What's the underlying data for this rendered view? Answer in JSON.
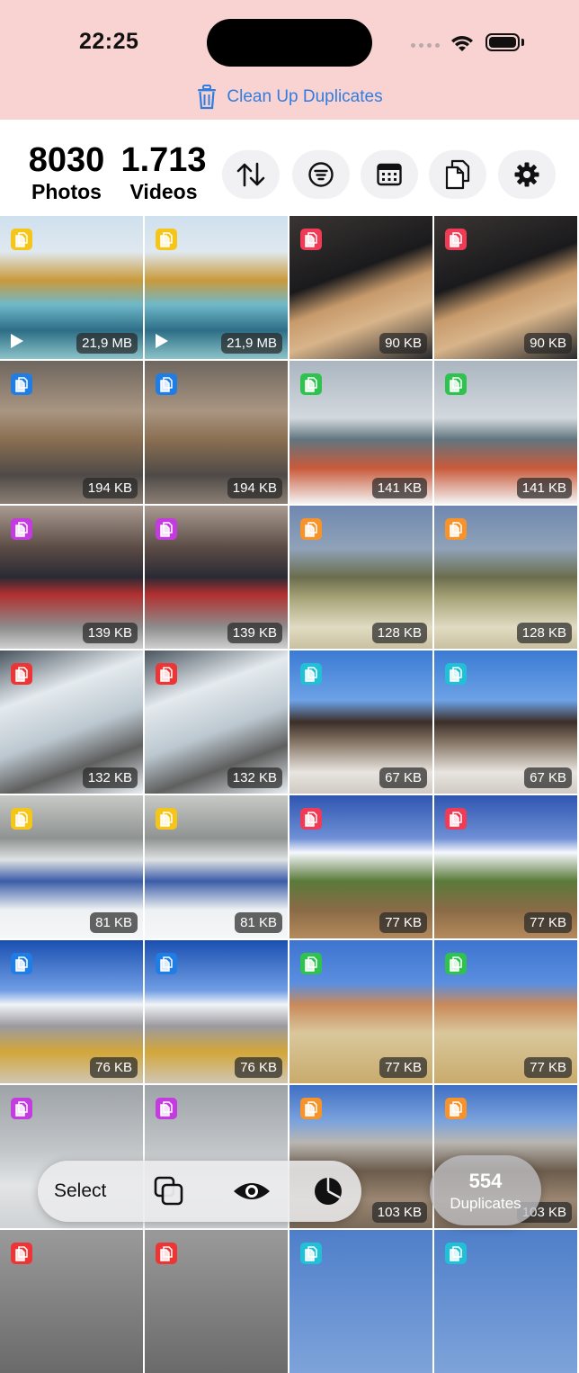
{
  "status": {
    "time": "22:25"
  },
  "cleanup": {
    "label": "Clean Up Duplicates"
  },
  "stats": {
    "photos_count": "8030",
    "photos_label": "Photos",
    "videos_count": "1.713",
    "videos_label": "Videos"
  },
  "header_icons": [
    "sort-icon",
    "filter-icon",
    "calendar-icon",
    "duplicates-icon",
    "gear-icon"
  ],
  "grid": {
    "rows": [
      {
        "sizes": [
          "21,9 MB",
          "21,9 MB",
          "90 KB",
          "90 KB"
        ],
        "badges": [
          "#f5c518",
          "#f5c518",
          "#ef3b56",
          "#ef3b56"
        ],
        "video": [
          true,
          true,
          false,
          false
        ]
      },
      {
        "sizes": [
          "194 KB",
          "194 KB",
          "141 KB",
          "141 KB"
        ],
        "badges": [
          "#1f7ee6",
          "#1f7ee6",
          "#2fc24e",
          "#2fc24e"
        ],
        "video": [
          false,
          false,
          false,
          false
        ]
      },
      {
        "sizes": [
          "139 KB",
          "139 KB",
          "128 KB",
          "128 KB"
        ],
        "badges": [
          "#c43be0",
          "#c43be0",
          "#f6932b",
          "#f6932b"
        ],
        "video": [
          false,
          false,
          false,
          false
        ]
      },
      {
        "sizes": [
          "132 KB",
          "132 KB",
          "67 KB",
          "67 KB"
        ],
        "badges": [
          "#ee3535",
          "#ee3535",
          "#21c0d6",
          "#21c0d6"
        ],
        "video": [
          false,
          false,
          false,
          false
        ]
      },
      {
        "sizes": [
          "81 KB",
          "81 KB",
          "77 KB",
          "77 KB"
        ],
        "badges": [
          "#f5c518",
          "#f5c518",
          "#ef3b56",
          "#ef3b56"
        ],
        "video": [
          false,
          false,
          false,
          false
        ]
      },
      {
        "sizes": [
          "76 KB",
          "76 KB",
          "77 KB",
          "77 KB"
        ],
        "badges": [
          "#1f7ee6",
          "#1f7ee6",
          "#2fc24e",
          "#2fc24e"
        ],
        "video": [
          false,
          false,
          false,
          false
        ]
      },
      {
        "sizes": [
          "",
          "",
          "103 KB",
          "103 KB"
        ],
        "badges": [
          "#c43be0",
          "#c43be0",
          "#f6932b",
          "#f6932b"
        ],
        "video": [
          false,
          false,
          false,
          false
        ]
      },
      {
        "sizes": [
          "",
          "",
          "",
          ""
        ],
        "badges": [
          "#ee3535",
          "#ee3535",
          "#21c0d6",
          "#21c0d6"
        ],
        "video": [
          false,
          false,
          false,
          false
        ]
      }
    ]
  },
  "toolbar": {
    "select_label": "Select",
    "icons": [
      "copy-icon",
      "eye-icon",
      "pie-chart-icon"
    ]
  },
  "duplicates": {
    "count": "554",
    "label": "Duplicates"
  },
  "colors": {
    "accent": "#2f7de0",
    "status_bg": "#f9d3d2"
  }
}
